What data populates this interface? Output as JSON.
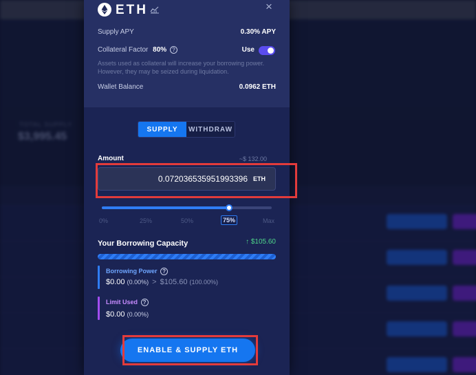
{
  "background": {
    "stat_label": "TOTAL SUPPLY",
    "stat_value": "$3,995.45"
  },
  "modal": {
    "coin": {
      "symbol": "ETH",
      "icon": "ethereum-icon",
      "chart_icon": "chart-icon"
    },
    "close_icon": "×",
    "supply_apy": {
      "label": "Supply APY",
      "value": "0.30% APY"
    },
    "collateral": {
      "label": "Collateral Factor",
      "factor": "80%",
      "toggle_label": "Use",
      "enabled": true,
      "note": "Assets used as collateral will increase your borrowing power. However, they may be seized during liquidation."
    },
    "wallet": {
      "label": "Wallet Balance",
      "value": "0.0962 ETH"
    },
    "tabs": [
      {
        "label": "SUPPLY",
        "active": true
      },
      {
        "label": "WITHDRAW",
        "active": false
      }
    ],
    "amount": {
      "label": "Amount",
      "usd": "~$ 132.00",
      "value": "0.072036535951993396",
      "unit": "ETH"
    },
    "slider": {
      "value_fraction": 0.75,
      "ticks": [
        "0%",
        "25%",
        "50%",
        "75%",
        "Max"
      ],
      "active_tick": "75%"
    },
    "capacity": {
      "title": "Your Borrowing Capacity",
      "value": "↑ $105.60"
    },
    "borrowing_power": {
      "title": "Borrowing Power",
      "value": "$0.00",
      "pct": "(0.00%)",
      "arrow": ">",
      "after_value": "$105.60",
      "after_pct": "(100.00%)"
    },
    "limit_used": {
      "title": "Limit Used",
      "value": "$0.00",
      "pct": "(0.00%)"
    },
    "cta_label": "ENABLE & SUPPLY ETH"
  },
  "colors": {
    "accent": "#1576f0",
    "positive": "#4fd68a",
    "purple": "#a24df0",
    "highlight": "#e33b3b"
  }
}
